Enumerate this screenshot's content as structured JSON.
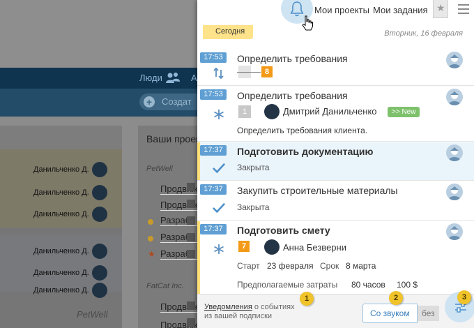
{
  "background": {
    "people_link": "Люди",
    "cut_link": "А",
    "create_button": "Создат",
    "projects_title": "Ваши проек",
    "owner_rows": [
      "Данильченко Д.",
      "Данильченко Д.",
      "Данильченко Д.",
      "Данильченко Д.",
      "Данильченко Д.",
      "Данильченко Д."
    ],
    "group_petwell": "PetWell",
    "group_fatcat": "FatCat Inc.",
    "footer_petwell": "PetWell",
    "project_items": [
      "Продвиж",
      "Продвиж",
      "Разрабо",
      "Разрабо",
      "Разрабо",
      "Продвиж",
      "Продвиж"
    ]
  },
  "topbar": {
    "my_projects": "Мои проекты",
    "my_tasks": "Мои задания"
  },
  "date_row": {
    "today": "Сегодня",
    "date": "Вторник, 16 февраля"
  },
  "notifications": [
    {
      "time": "17:53",
      "title": "Определить требования",
      "icon": "swap-arrows-icon",
      "badge_orange": "8"
    },
    {
      "time": "17:53",
      "title": "Определить требования",
      "icon": "asterisk-icon",
      "badge_grey": "1",
      "person": "Дмитрий Данильченко",
      "new_label": ">> New",
      "description": "Определить требования клиента."
    },
    {
      "time": "17:37",
      "title": "Подготовить документацию",
      "icon": "checkmark-icon",
      "status": "Закрыта"
    },
    {
      "time": "17:37",
      "title": "Закупить строительные материалы",
      "icon": "checkmark-icon",
      "status": "Закрыта"
    },
    {
      "time": "17:37",
      "title": "Подготовить смету",
      "icon": "asterisk-icon",
      "badge_orange": "7",
      "person": "Анна Безверни",
      "start_label": "Старт",
      "start_value": "23 февраля",
      "due_label": "Срок",
      "due_value": "8 марта",
      "cost_label": "Предполагаемые затраты",
      "hours": "80 часов",
      "money": "100 $"
    }
  ],
  "footer": {
    "link_text": "Уведомления",
    "rest_line1": " о событиях",
    "line2": "из вашей подписки",
    "sound_on": "Со звуком",
    "sound_off": "без",
    "markers": [
      "1",
      "2",
      "3"
    ]
  },
  "colors": {
    "time_badge": "#5f9fd3",
    "today_badge": "#ffe38a",
    "orange_badge": "#f39a18",
    "new_badge": "#7ec16b",
    "marker": "#f0c32a"
  }
}
